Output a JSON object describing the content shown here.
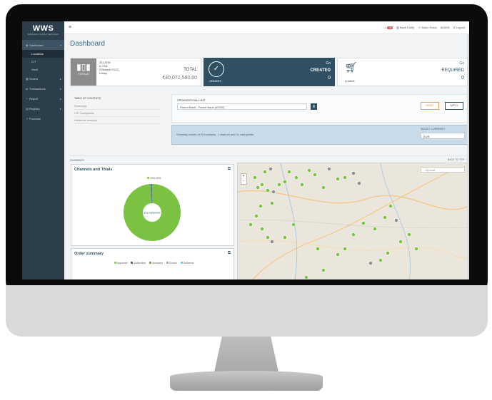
{
  "sidebar": {
    "logo": "WWS",
    "logo_tagline": "WIRELESS WORLD SERVICES",
    "items": [
      {
        "label": "Dashboard",
        "icon": "dashboard-icon",
        "chevron": "▾"
      },
      {
        "label": "Locations"
      },
      {
        "label": "CIT"
      },
      {
        "label": "Vault"
      },
      {
        "label": "Orders",
        "icon": "orders-icon",
        "chevron": "▸"
      },
      {
        "label": "Transactions",
        "icon": "transactions-icon",
        "chevron": "▸"
      },
      {
        "label": "Report",
        "icon": "report-icon",
        "chevron": "▸"
      },
      {
        "label": "Registry",
        "icon": "registry-icon",
        "chevron": "▸"
      },
      {
        "label": "Forecast",
        "icon": "forecast-icon"
      }
    ]
  },
  "topbar": {
    "notification_count": "18",
    "bank": "Bank Entity",
    "user": "Mario Rossi",
    "role": "ADMIN",
    "logout": "Logout"
  },
  "page": {
    "title": "Dashboard"
  },
  "cards": {
    "totals": {
      "label": "TOTALS",
      "lines": [
        "311 ATM",
        "0 CSA",
        "0 Branch CICO",
        "Lobby"
      ],
      "total_label": "TOTAL",
      "amount": "€40,072,580.00"
    },
    "orders": {
      "label": "ORDERS",
      "go": "Go",
      "status": "CREATED",
      "count": "0"
    },
    "loads": {
      "label": "LOADS",
      "go": "Go",
      "status": "REQUIRED",
      "count": "0"
    }
  },
  "toc": {
    "heading": "TABLE OF CONTENTS",
    "items": [
      "Summary",
      "VIP Cashpoints",
      "Historical analysis"
    ]
  },
  "org": {
    "label": "ORGANIZATIONAL UNIT",
    "value": "Parent Bank - Parent Bank (00500)",
    "reset": "RESET",
    "apply": "APPLY"
  },
  "info": {
    "message": "Showing results of 23 locations, 1 channel and 41 cashpoints",
    "currency_label": "SELECT CURRENCY",
    "currency_value": "EUR"
  },
  "summary": {
    "label": "SUMMARY",
    "back_to_top": "BACK TO TOP"
  },
  "channels_panel": {
    "title": "Channels and Totals",
    "legend": "99% ATM",
    "center": "311 cashpoints",
    "chart_data": {
      "type": "pie",
      "categories": [
        "ATM"
      ],
      "values": [
        99
      ],
      "legend_position": "top"
    }
  },
  "orders_panel": {
    "title": "Order summary",
    "legend": [
      {
        "name": "Approved",
        "color": "#8bc34a"
      },
      {
        "name": "Authorized",
        "color": "#2f4f63"
      },
      {
        "name": "Accepted",
        "color": "#6d8b3a"
      },
      {
        "name": "Closed",
        "color": "#9e9e9e"
      },
      {
        "name": "Delivered",
        "color": "#5bc0de"
      }
    ]
  },
  "map": {
    "search_placeholder": "Zip code",
    "zoom_in": "+",
    "zoom_out": "−"
  },
  "colors": {
    "accent": "#2f4f63",
    "sidebar": "#2c3e4a",
    "pin": "#7cc242",
    "pin_inactive": "#8e8e8e"
  }
}
